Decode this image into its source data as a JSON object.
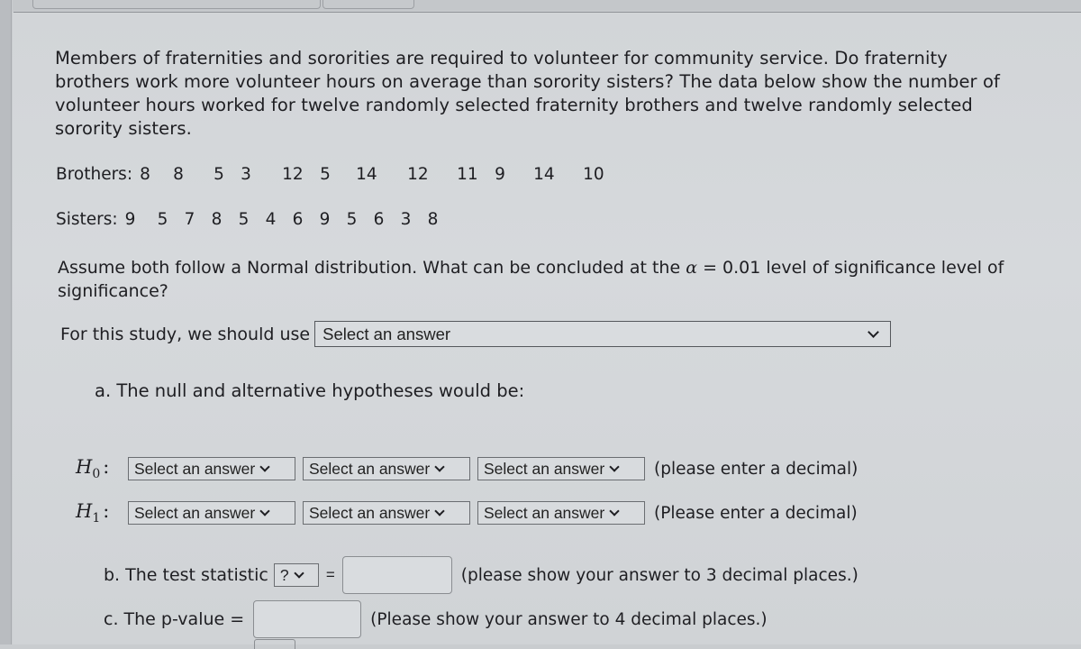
{
  "question": {
    "intro": "Members of fraternities and sororities are required to volunteer for community service. Do fraternity brothers work more volunteer hours on average than sorority sisters? The data below show the number of volunteer hours worked for twelve randomly selected fraternity brothers and twelve randomly selected sorority sisters.",
    "brothers": {
      "label": "Brothers:",
      "values": [
        "8",
        "8",
        "5",
        "3",
        "12",
        "5",
        "14",
        "12",
        "11",
        "9",
        "14",
        "10"
      ]
    },
    "sisters": {
      "label": "Sisters:",
      "values": [
        "9",
        "5",
        "7",
        "8",
        "5",
        "4",
        "6",
        "9",
        "5",
        "6",
        "3",
        "8"
      ]
    },
    "assume_prefix": "Assume both follow a Normal distribution.  What can be concluded at the ",
    "alpha_symbol": "α",
    "assume_suffix": " = 0.01 level of significance level of significance?"
  },
  "study": {
    "label": "For this study, we should use",
    "select_value": "Select an answer"
  },
  "part_a": {
    "title": "a. The null and alternative hypotheses would be:",
    "h0": {
      "symbol": "H",
      "subscript": "0",
      "colon": ":",
      "selects": [
        "Select an answer",
        "Select an answer",
        "Select an answer"
      ],
      "hint": "(please enter a decimal)"
    },
    "h1": {
      "symbol": "H",
      "subscript": "1",
      "colon": ":",
      "selects": [
        "Select an answer",
        "Select an answer",
        "Select an answer"
      ],
      "hint": "(Please enter a decimal)"
    }
  },
  "part_b": {
    "label": "b. The test statistic",
    "select_value": "?",
    "equals": "=",
    "input_value": "",
    "hint": "(please show your answer to 3 decimal places.)"
  },
  "part_c": {
    "label": "c. The p-value =",
    "input_value": "",
    "hint": "(Please show your answer to 4 decimal places.)"
  }
}
